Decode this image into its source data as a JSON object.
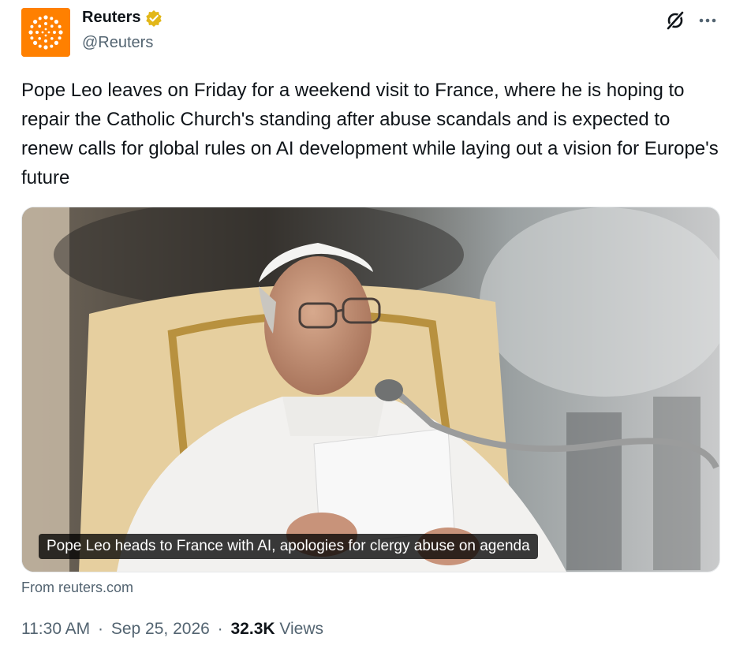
{
  "account": {
    "name": "Reuters",
    "handle": "@Reuters",
    "verified_badge_color": "#e2b719",
    "avatar_color": "#ff8000",
    "icons": [
      "verified-badge-icon",
      "grok-icon",
      "more-icon"
    ]
  },
  "tweet": {
    "text": "Pope Leo leaves on Friday for a weekend visit to France, where he is hoping to repair the Catholic Church's standing after abuse scandals and is expected to renew calls for global rules on AI development while laying out a vision for Europe's future"
  },
  "card": {
    "caption": "Pope Leo heads to France with AI, apologies for clergy abuse on agenda",
    "source": "From reuters.com"
  },
  "meta": {
    "time": "11:30 AM",
    "date": "Sep 25, 2026",
    "separator": "·",
    "views_count": "32.3K",
    "views_label": "Views"
  }
}
